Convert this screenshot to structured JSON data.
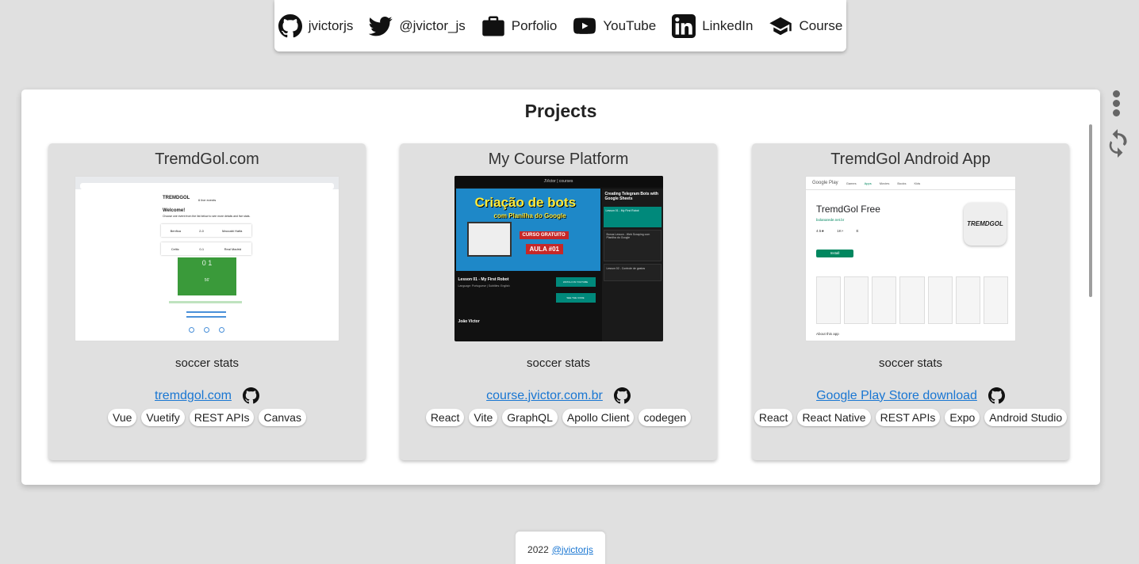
{
  "nav": {
    "items": [
      {
        "label": "jvictorjs",
        "icon": "github-icon"
      },
      {
        "label": "@jvictor_js",
        "icon": "twitter-icon"
      },
      {
        "label": "Porfolio",
        "icon": "briefcase-icon"
      },
      {
        "label": "YouTube",
        "icon": "youtube-icon"
      },
      {
        "label": "LinkedIn",
        "icon": "linkedin-icon"
      },
      {
        "label": "Course",
        "icon": "graduation-cap-icon"
      }
    ]
  },
  "projects": {
    "title": "Projects",
    "cards": [
      {
        "title": "TremdGol.com",
        "description": "soccer stats",
        "link_label": "tremdgol.com",
        "chips": [
          "Vue",
          "Vuetify",
          "REST APIs",
          "Canvas"
        ],
        "thumb": {
          "logo": "TREMDGOL",
          "welcome": "Welcome!",
          "subtitle": "Choose one event from the list below to see more details and live stats.",
          "events_label": "6 live events",
          "match1": {
            "home": "Benfica",
            "score": "2-0",
            "away": "Maccabi Haifa"
          },
          "match2": {
            "home": "Celtic",
            "score": "0-1",
            "away": "Real Madrid"
          },
          "pitch_score": "0  1",
          "minute": "56'"
        }
      },
      {
        "title": "My Course Platform",
        "description": "soccer stats",
        "link_label": "course.jvictor.com.br",
        "chips": [
          "React",
          "Vite",
          "GraphQL",
          "Apollo Client",
          "codegen"
        ],
        "thumb": {
          "brand": "JVictor | courses",
          "banner_line1": "Criação de bots",
          "banner_line2": "com Planilha do Google",
          "badge1": "CURSO GRATUITO",
          "badge2": "AULA #01",
          "sidebar_title": "Creating Telegram Bots with Google Sheets",
          "lesson_title": "Lesson 01 - My First Robot",
          "lesson_meta": "Language: Portuguese | Subtitles: English",
          "author": "João Victor",
          "sidebar_lesson1": "Lesson 01 - My First Robot",
          "sidebar_lesson2": "Bonus Lesson - Web Scraping com Planilha do Google",
          "sidebar_lesson3": "Lesson 02 - Controle de gastos",
          "btn1": "WATCH ON YOUTUBE",
          "btn2": "SEE THE CODE"
        }
      },
      {
        "title": "TremdGol Android App",
        "description": "soccer stats",
        "link_label": "Google Play Store download",
        "chips": [
          "React",
          "React Native",
          "REST APIs",
          "Expo",
          "Android Studio"
        ],
        "thumb": {
          "store": "Google Play",
          "tabs": [
            "Games",
            "Apps",
            "Movies",
            "Books",
            "Kids"
          ],
          "app_name": "TremdGol Free",
          "developer": "bolanarede.net.br",
          "stats": [
            "4.5★",
            "1K+",
            "E"
          ],
          "install": "Install",
          "logo": "TREMDGOL",
          "about": "About this app"
        }
      }
    ]
  },
  "footer": {
    "year": "2022",
    "handle": "@jvictorjs"
  },
  "colors": {
    "background": "#e0e0e0",
    "link": "#1976d2",
    "card": "#e0e0e0"
  }
}
